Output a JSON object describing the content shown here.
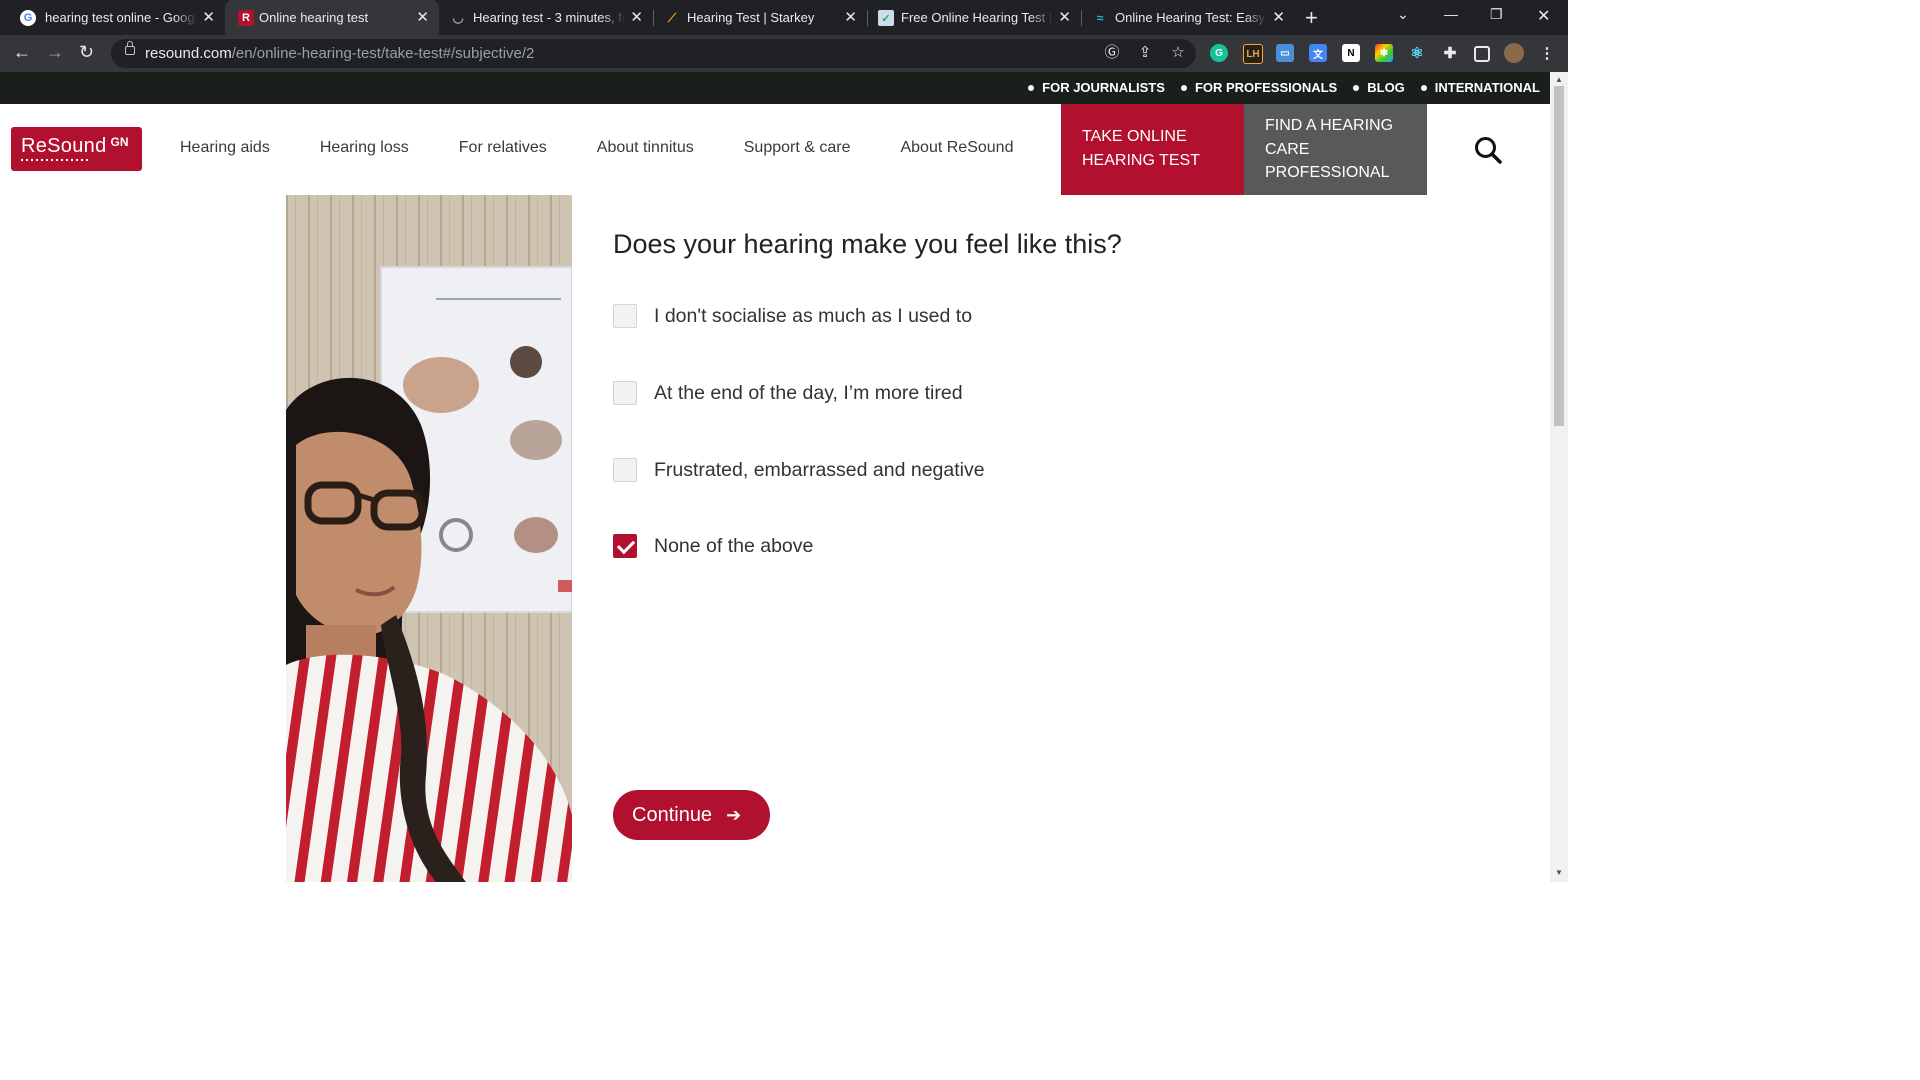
{
  "browser": {
    "tabs": [
      {
        "title": "hearing test online - Google Search",
        "active": false,
        "icon": "google-g"
      },
      {
        "title": "Online hearing test",
        "active": true,
        "icon": "resound-r"
      },
      {
        "title": "Hearing test - 3 minutes, free",
        "active": false,
        "icon": "shield"
      },
      {
        "title": "Hearing Test | Starkey",
        "active": false,
        "icon": "starkey"
      },
      {
        "title": "Free Online Hearing Test | Tinnitus",
        "active": false,
        "icon": "checkmark-box"
      },
      {
        "title": "Online Hearing Test: Easy, Fast",
        "active": false,
        "icon": "wave"
      }
    ],
    "url": {
      "host": "resound.com",
      "path": "/en/online-hearing-test/take-test#/subjective/2"
    }
  },
  "topbar": {
    "links": [
      "FOR JOURNALISTS",
      "FOR PROFESSIONALS",
      "BLOG",
      "INTERNATIONAL"
    ]
  },
  "header": {
    "logo": {
      "brand": "ReSound",
      "suffix": "GN"
    },
    "nav": [
      "Hearing aids",
      "Hearing loss",
      "For relatives",
      "About tinnitus",
      "Support & care",
      "About ReSound"
    ],
    "cta_primary": [
      "TAKE ONLINE",
      "HEARING TEST"
    ],
    "cta_secondary": [
      "FIND A HEARING",
      "CARE",
      "PROFESSIONAL"
    ]
  },
  "quiz": {
    "question": "Does your hearing make you feel like this?",
    "options": [
      {
        "label": "I don't socialise as much as I used to",
        "checked": false
      },
      {
        "label": "At the end of the day, I’m more tired",
        "checked": false
      },
      {
        "label": "Frustrated, embarrassed and negative",
        "checked": false
      },
      {
        "label": "None of the above",
        "checked": true
      }
    ],
    "continue_label": "Continue"
  },
  "colors": {
    "brand_red": "#b2102f",
    "cta_gray": "#58595b",
    "top_strip": "#1a1f1b"
  }
}
